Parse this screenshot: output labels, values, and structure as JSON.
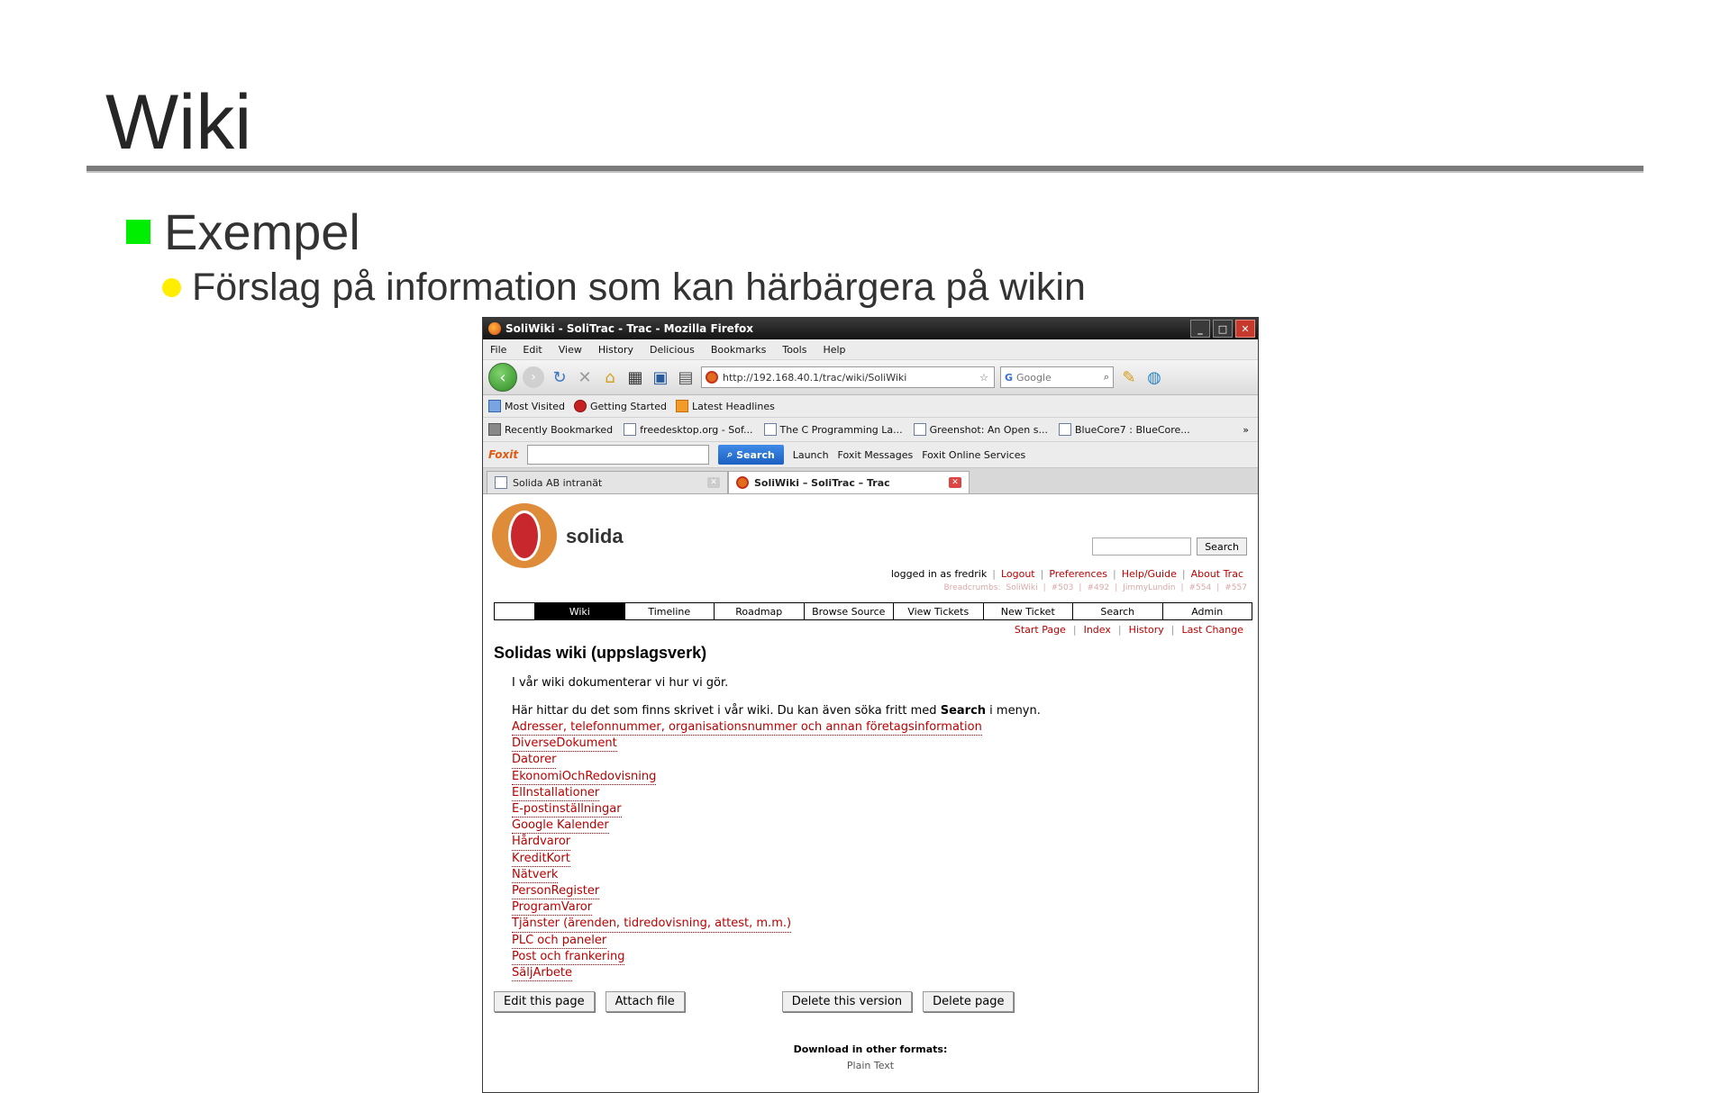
{
  "slide": {
    "title": "Wiki",
    "bullet1": "Exempel",
    "bullet2": "Förslag på information som kan härbärgera på wikin"
  },
  "browser": {
    "window_title": "SoliWiki - SoliTrac - Trac - Mozilla Firefox",
    "menu": [
      "File",
      "Edit",
      "View",
      "History",
      "Delicious",
      "Bookmarks",
      "Tools",
      "Help"
    ],
    "url": "http://192.168.40.1/trac/wiki/SoliWiki",
    "search_placeholder": "Google",
    "bookmarks1": [
      "Most Visited",
      "Getting Started",
      "Latest Headlines"
    ],
    "bookmarks2": [
      "Recently Bookmarked",
      "freedesktop.org - Sof...",
      "The C Programming La...",
      "Greenshot: An Open s...",
      "BlueCore7 : BlueCore..."
    ],
    "foxit": {
      "logo": "Foxit",
      "search_label": "Search",
      "items": [
        "Launch",
        "Foxit Messages",
        "Foxit Online Services"
      ]
    },
    "tabs": [
      "Solida AB intranät",
      "SoliWiki – SoliTrac – Trac"
    ]
  },
  "trac": {
    "brand": "solida",
    "search_button": "Search",
    "metanav": [
      "logged in as fredrik",
      "Logout",
      "Preferences",
      "Help/Guide",
      "About Trac"
    ],
    "breadcrumbs": [
      "Breadcrumbs:",
      "SoliWiki",
      "#503",
      "#492",
      "JimmyLundin",
      "#554",
      "#557"
    ],
    "mainnav": [
      "Wiki",
      "Timeline",
      "Roadmap",
      "Browse Source",
      "View Tickets",
      "New Ticket",
      "Search",
      "Admin"
    ],
    "ctxnav": [
      "Start Page",
      "Index",
      "History",
      "Last Change"
    ],
    "heading": "Solidas wiki (uppslagsverk)",
    "intro": "I vår wiki dokumenterar vi hur vi gör.",
    "intro2_pre": "Här hittar du det som finns skrivet i vår wiki. Du kan även söka fritt med ",
    "intro2_bold": "Search",
    "intro2_post": " i menyn.",
    "links": [
      "Adresser, telefonnummer, organisationsnummer och annan företagsinformation",
      "DiverseDokument",
      "Datorer",
      "EkonomiOchRedovisning",
      "ElInstallationer",
      "E-postinställningar",
      "Google Kalender",
      "Hårdvaror",
      "KreditKort",
      "Nätverk",
      "PersonRegister",
      "ProgramVaror",
      "Tjänster (ärenden, tidredovisning, attest, m.m.)",
      "PLC och paneler",
      "Post och frankering",
      "SäljArbete"
    ],
    "buttons": [
      "Edit this page",
      "Attach file",
      "Delete this version",
      "Delete page"
    ],
    "download_label": "Download in other formats:",
    "download_format": "Plain Text"
  }
}
